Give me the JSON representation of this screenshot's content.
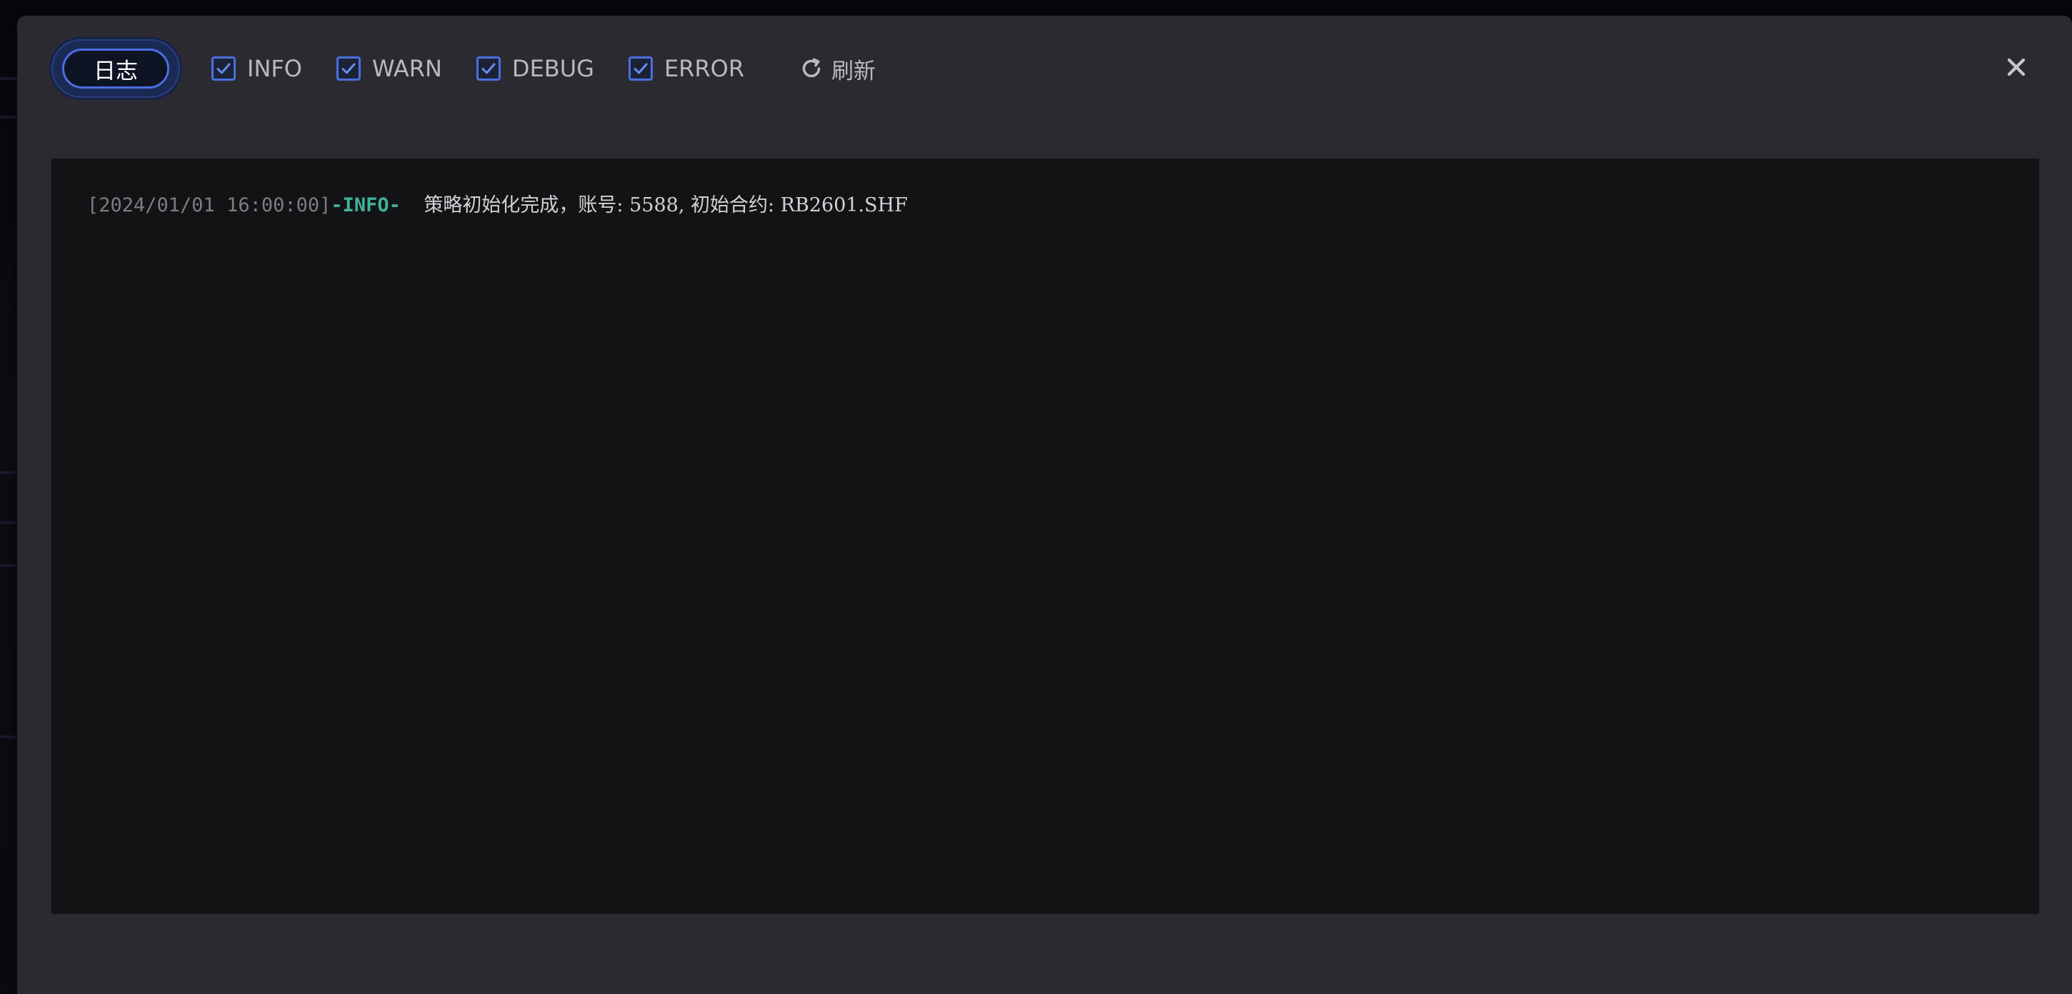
{
  "toolbar": {
    "log_tab_label": "日志",
    "filters": [
      {
        "label": "INFO",
        "checked": true
      },
      {
        "label": "WARN",
        "checked": true
      },
      {
        "label": "DEBUG",
        "checked": true
      },
      {
        "label": "ERROR",
        "checked": true
      }
    ],
    "refresh_label": "刷新"
  },
  "log": {
    "entries": [
      {
        "timestamp": "[2024/01/01 16:00:00]",
        "level": "-INFO-",
        "message": "策略初始化完成，账号: 5588, 初始合约: RB2601.SHF"
      }
    ]
  },
  "colors": {
    "accent": "#4a6fe0",
    "info_level": "#3fb39a",
    "dialog_bg": "#2a2a30",
    "log_bg": "#131315"
  },
  "icons": {
    "checkbox": "check-icon",
    "refresh": "refresh-icon",
    "close": "close-icon"
  }
}
